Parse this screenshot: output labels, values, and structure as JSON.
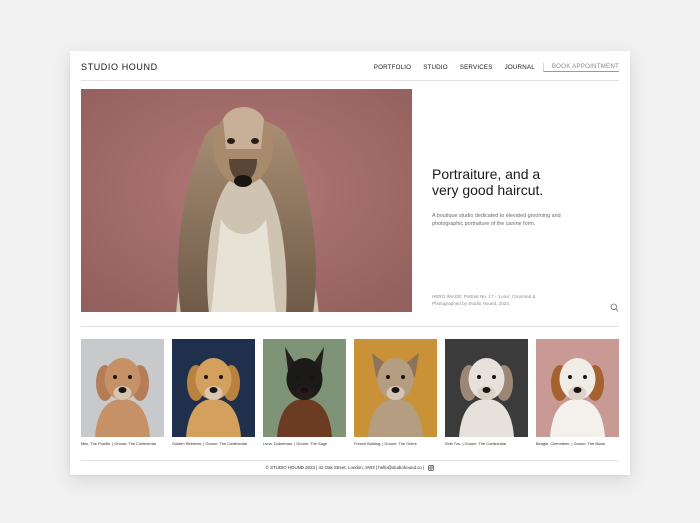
{
  "header": {
    "brand": "STUDIO HOUND",
    "nav": [
      "PORTFOLIO",
      "STUDIO",
      "SERVICES",
      "JOURNAL"
    ],
    "book_label": "BOOK APPOINTMENT"
  },
  "hero": {
    "title_line1": "Portraiture, and a",
    "title_line2": "very good haircut.",
    "subtitle": "A boutique studio dedicated to elevated grooming and photographic portraiture of the canine form.",
    "caption": "HERO IMAGE: Portrait No. 17 - 'Luna', Groomed & Photographed by Studio Hound, 2023.",
    "background": "#a26a68"
  },
  "gallery": [
    {
      "label": "Milo, The Poodle. | Groom: The Continental",
      "bg": "#c7c9cb",
      "fur": "#c79167",
      "ear": "#b57d55"
    },
    {
      "label": "Golden Retriever. | Groom: The Continental",
      "bg": "#1f2f4c",
      "fur": "#d3a05d",
      "ear": "#b9833f"
    },
    {
      "label": "Luna, Doberman. | Groom: The Sage",
      "bg": "#7f9376",
      "fur": "#1c1a19",
      "ear": "#241f1c"
    },
    {
      "label": "French Bulldog. | Groom: The Ochre",
      "bg": "#c99236",
      "fur": "#b59d82",
      "ear": "#8d735c"
    },
    {
      "label": "Shih Tzu. | Groom: The Continental",
      "bg": "#3b3b3b",
      "fur": "#e6e1da",
      "ear": "#9b8776"
    },
    {
      "label": "Beagle, Chenoteen. | Groom: The Blush",
      "bg": "#c99a95",
      "fur": "#f0ece6",
      "ear": "#a5622e"
    }
  ],
  "footer": {
    "text": "© STUDIO HOUND 2023 | 42 Oak Street, London, SW3 | hello@studiohound.co |"
  }
}
